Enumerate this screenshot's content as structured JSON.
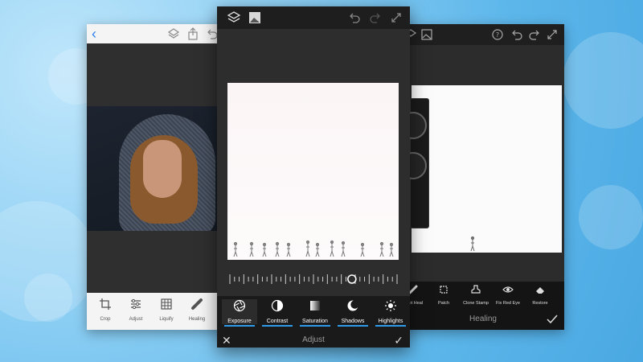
{
  "left_phone": {
    "tools": [
      {
        "label": "Crop",
        "icon": "crop-icon"
      },
      {
        "label": "Adjust",
        "icon": "sliders-icon"
      },
      {
        "label": "Liquify",
        "icon": "grid-icon"
      },
      {
        "label": "Healing",
        "icon": "bandage-icon"
      }
    ]
  },
  "center_phone": {
    "adjustments": [
      {
        "label": "Exposure",
        "icon": "aperture-icon",
        "selected": true
      },
      {
        "label": "Contrast",
        "icon": "contrast-icon"
      },
      {
        "label": "Saturation",
        "icon": "saturation-icon"
      },
      {
        "label": "Shadows",
        "icon": "moon-icon"
      },
      {
        "label": "Highlights",
        "icon": "sun-icon"
      }
    ],
    "panel_title": "Adjust",
    "slider_value": 0.73
  },
  "right_phone": {
    "tools": [
      {
        "label": "Spot Heal",
        "icon": "bandage-icon"
      },
      {
        "label": "Patch",
        "icon": "patch-icon"
      },
      {
        "label": "Clone Stamp",
        "icon": "stamp-icon"
      },
      {
        "label": "Fix Red Eye",
        "icon": "eye-icon"
      },
      {
        "label": "Restore",
        "icon": "eraser-icon"
      }
    ],
    "panel_title": "Healing"
  },
  "colors": {
    "accent": "#2f9be8",
    "back_arrow": "#2a7ff0"
  }
}
